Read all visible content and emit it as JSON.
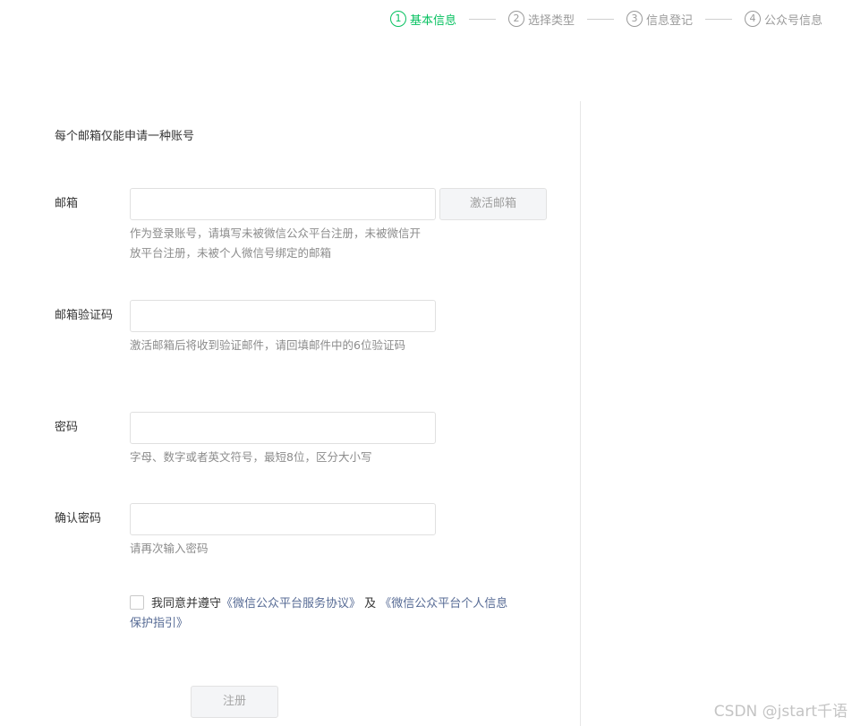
{
  "steps": [
    {
      "num": "1",
      "label": "基本信息"
    },
    {
      "num": "2",
      "label": "选择类型"
    },
    {
      "num": "3",
      "label": "信息登记"
    },
    {
      "num": "4",
      "label": "公众号信息"
    }
  ],
  "colors": {
    "active": "#07c160",
    "link": "#576b95",
    "hint": "#8c8c8c"
  },
  "notice": "每个邮箱仅能申请一种账号",
  "email": {
    "label": "邮箱",
    "value": "",
    "activate_button": "激活邮箱",
    "hint": "作为登录账号，请填写未被微信公众平台注册，未被微信开放平台注册，未被个人微信号绑定的邮箱"
  },
  "code": {
    "label": "邮箱验证码",
    "value": "",
    "hint": "激活邮箱后将收到验证邮件，请回填邮件中的6位验证码"
  },
  "password": {
    "label": "密码",
    "value": "",
    "hint": "字母、数字或者英文符号，最短8位，区分大小写"
  },
  "confirm": {
    "label": "确认密码",
    "value": "",
    "hint": "请再次输入密码"
  },
  "agreement": {
    "prefix": "我同意并遵守",
    "link1": "《微信公众平台服务协议》",
    "and": " 及 ",
    "link2": "《微信公众平台个人信息保护指引》"
  },
  "register_button": "注册",
  "watermark": "CSDN @jstart千语"
}
